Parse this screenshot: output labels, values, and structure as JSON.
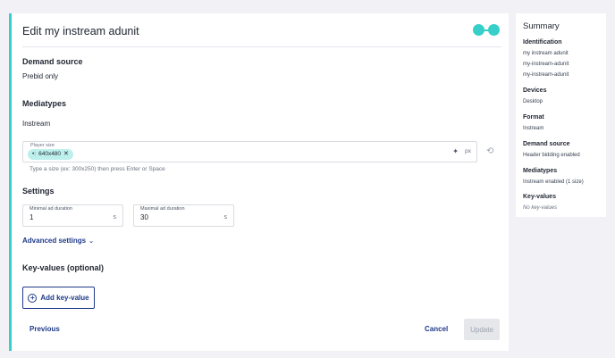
{
  "form": {
    "title": "Edit my instream adunit",
    "demand_source": {
      "heading": "Demand source",
      "value": "Prebid only"
    },
    "mediatypes": {
      "heading": "Mediatypes",
      "subheading": "Instream"
    },
    "player_size": {
      "label": "Player size",
      "chip": "640x480",
      "unit": "px",
      "hint": "Type a size (ex: 300x250) then press Enter or Space"
    },
    "settings": {
      "heading": "Settings",
      "min_label": "Minimal ad duration",
      "min_value": "1",
      "min_unit": "s",
      "max_label": "Maximal ad duration",
      "max_value": "30",
      "max_unit": "s"
    },
    "advanced": "Advanced settings",
    "key_values": {
      "heading": "Key-values (optional)",
      "add_button": "Add key-value"
    },
    "footer": {
      "previous": "Previous",
      "cancel": "Cancel",
      "update": "Update"
    },
    "accent_color": "#36cfc9",
    "link_color": "#1f3a8a"
  },
  "summary": {
    "title": "Summary",
    "identification": {
      "heading": "Identification",
      "lines": [
        "my instream adunit",
        "my-instream-adunit",
        "my-instream-adunit"
      ]
    },
    "devices": {
      "heading": "Devices",
      "value": "Desktop"
    },
    "format": {
      "heading": "Format",
      "value": "Instream"
    },
    "demand_source": {
      "heading": "Demand source",
      "value": "Header bidding enabled"
    },
    "mediatypes": {
      "heading": "Mediatypes",
      "value": "Instream enabled (1 size)"
    },
    "key_values": {
      "heading": "Key-values",
      "value": "No key-values"
    }
  }
}
